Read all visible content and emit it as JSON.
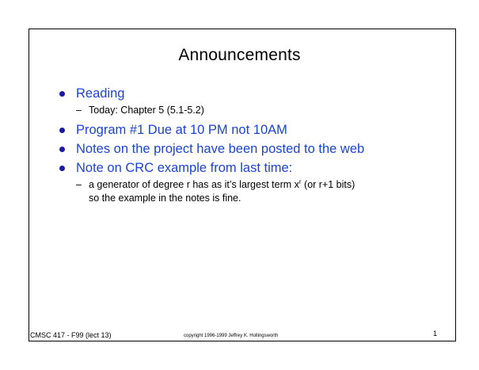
{
  "slide": {
    "title": "Announcements",
    "bullets": [
      {
        "text": "Reading",
        "subitems": [
          {
            "dash": "–",
            "text": "Today: Chapter 5 (5.1-5.2)"
          }
        ]
      },
      {
        "text": "Program #1 Due at 10 PM not 10AM"
      },
      {
        "text": "Notes on the project have been posted to the web"
      },
      {
        "text": "Note on CRC example from last time:",
        "subitems": [
          {
            "dash": "–",
            "text_part1": "a generator of degree r has as it’s largest term x",
            "superscript": "r",
            "text_part2": " (or r+1 bits)",
            "text_line2": "so the example in the notes is fine."
          }
        ]
      }
    ]
  },
  "footer": {
    "course": "CMSC 417 - F99  (lect 13)",
    "copyright": "copyright  1996-1999  Jeffrey K. Hollingsworth",
    "page_number": "1"
  },
  "colors": {
    "bullet_text": "#1a44d6",
    "bullet_dot": "#1a1aa6",
    "body_text": "#000000",
    "frame": "#000000"
  }
}
